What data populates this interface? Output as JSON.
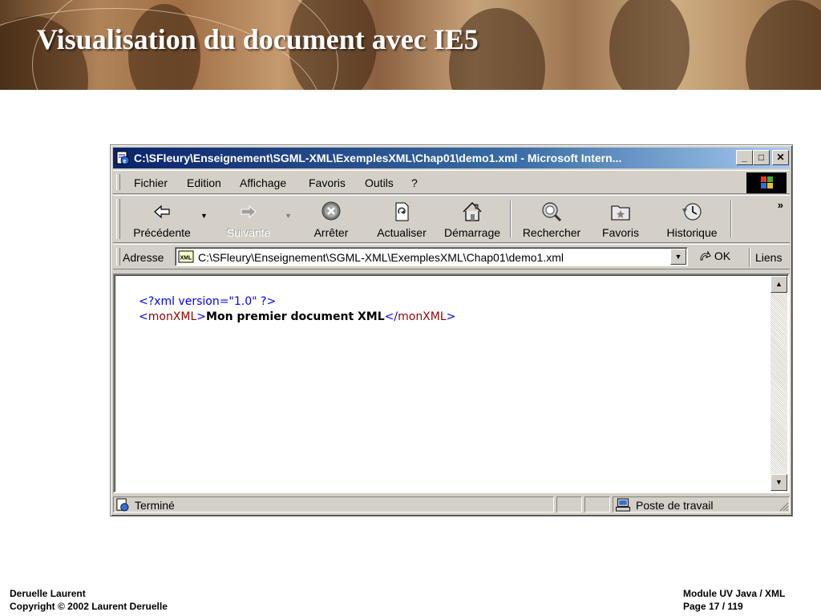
{
  "slide": {
    "title": "Visualisation du document avec IE5",
    "footer_left": [
      "Deruelle Laurent",
      "Copyright © 2002 Laurent Deruelle"
    ],
    "footer_right": [
      "Module UV Java / XML",
      "Page 17 / 119"
    ]
  },
  "window": {
    "title": "C:\\SFleury\\Enseignement\\SGML-XML\\ExemplesXML\\Chap01\\demo1.xml - Microsoft Intern...",
    "title_color": "#0a246a",
    "menu": [
      "Fichier",
      "Edition",
      "Affichage",
      "Favoris",
      "Outils",
      "?"
    ],
    "toolbar": [
      {
        "label": "Précédente",
        "icon": "back-arrow-icon",
        "enabled": true
      },
      {
        "label": "Suivante",
        "icon": "forward-arrow-icon",
        "enabled": false
      },
      {
        "label": "Arrêter",
        "icon": "stop-icon",
        "enabled": true
      },
      {
        "label": "Actualiser",
        "icon": "refresh-icon",
        "enabled": true
      },
      {
        "label": "Démarrage",
        "icon": "home-icon",
        "enabled": true
      },
      {
        "label": "Rechercher",
        "icon": "search-icon",
        "enabled": true
      },
      {
        "label": "Favoris",
        "icon": "favorites-icon",
        "enabled": true
      },
      {
        "label": "Historique",
        "icon": "history-icon",
        "enabled": true
      }
    ],
    "toolbar_more": "»",
    "address": {
      "label": "Adresse",
      "value": "C:\\SFleury\\Enseignement\\SGML-XML\\ExemplesXML\\Chap01\\demo1.xml",
      "go_label": "OK",
      "links_label": "Liens"
    },
    "document": {
      "pi": "<?xml version=\"1.0\" ?>",
      "open_tag": "monXML",
      "text": "Mon premier document XML",
      "close_tag": "monXML"
    },
    "status": {
      "text": "Terminé",
      "zone": "Poste de travail"
    }
  }
}
